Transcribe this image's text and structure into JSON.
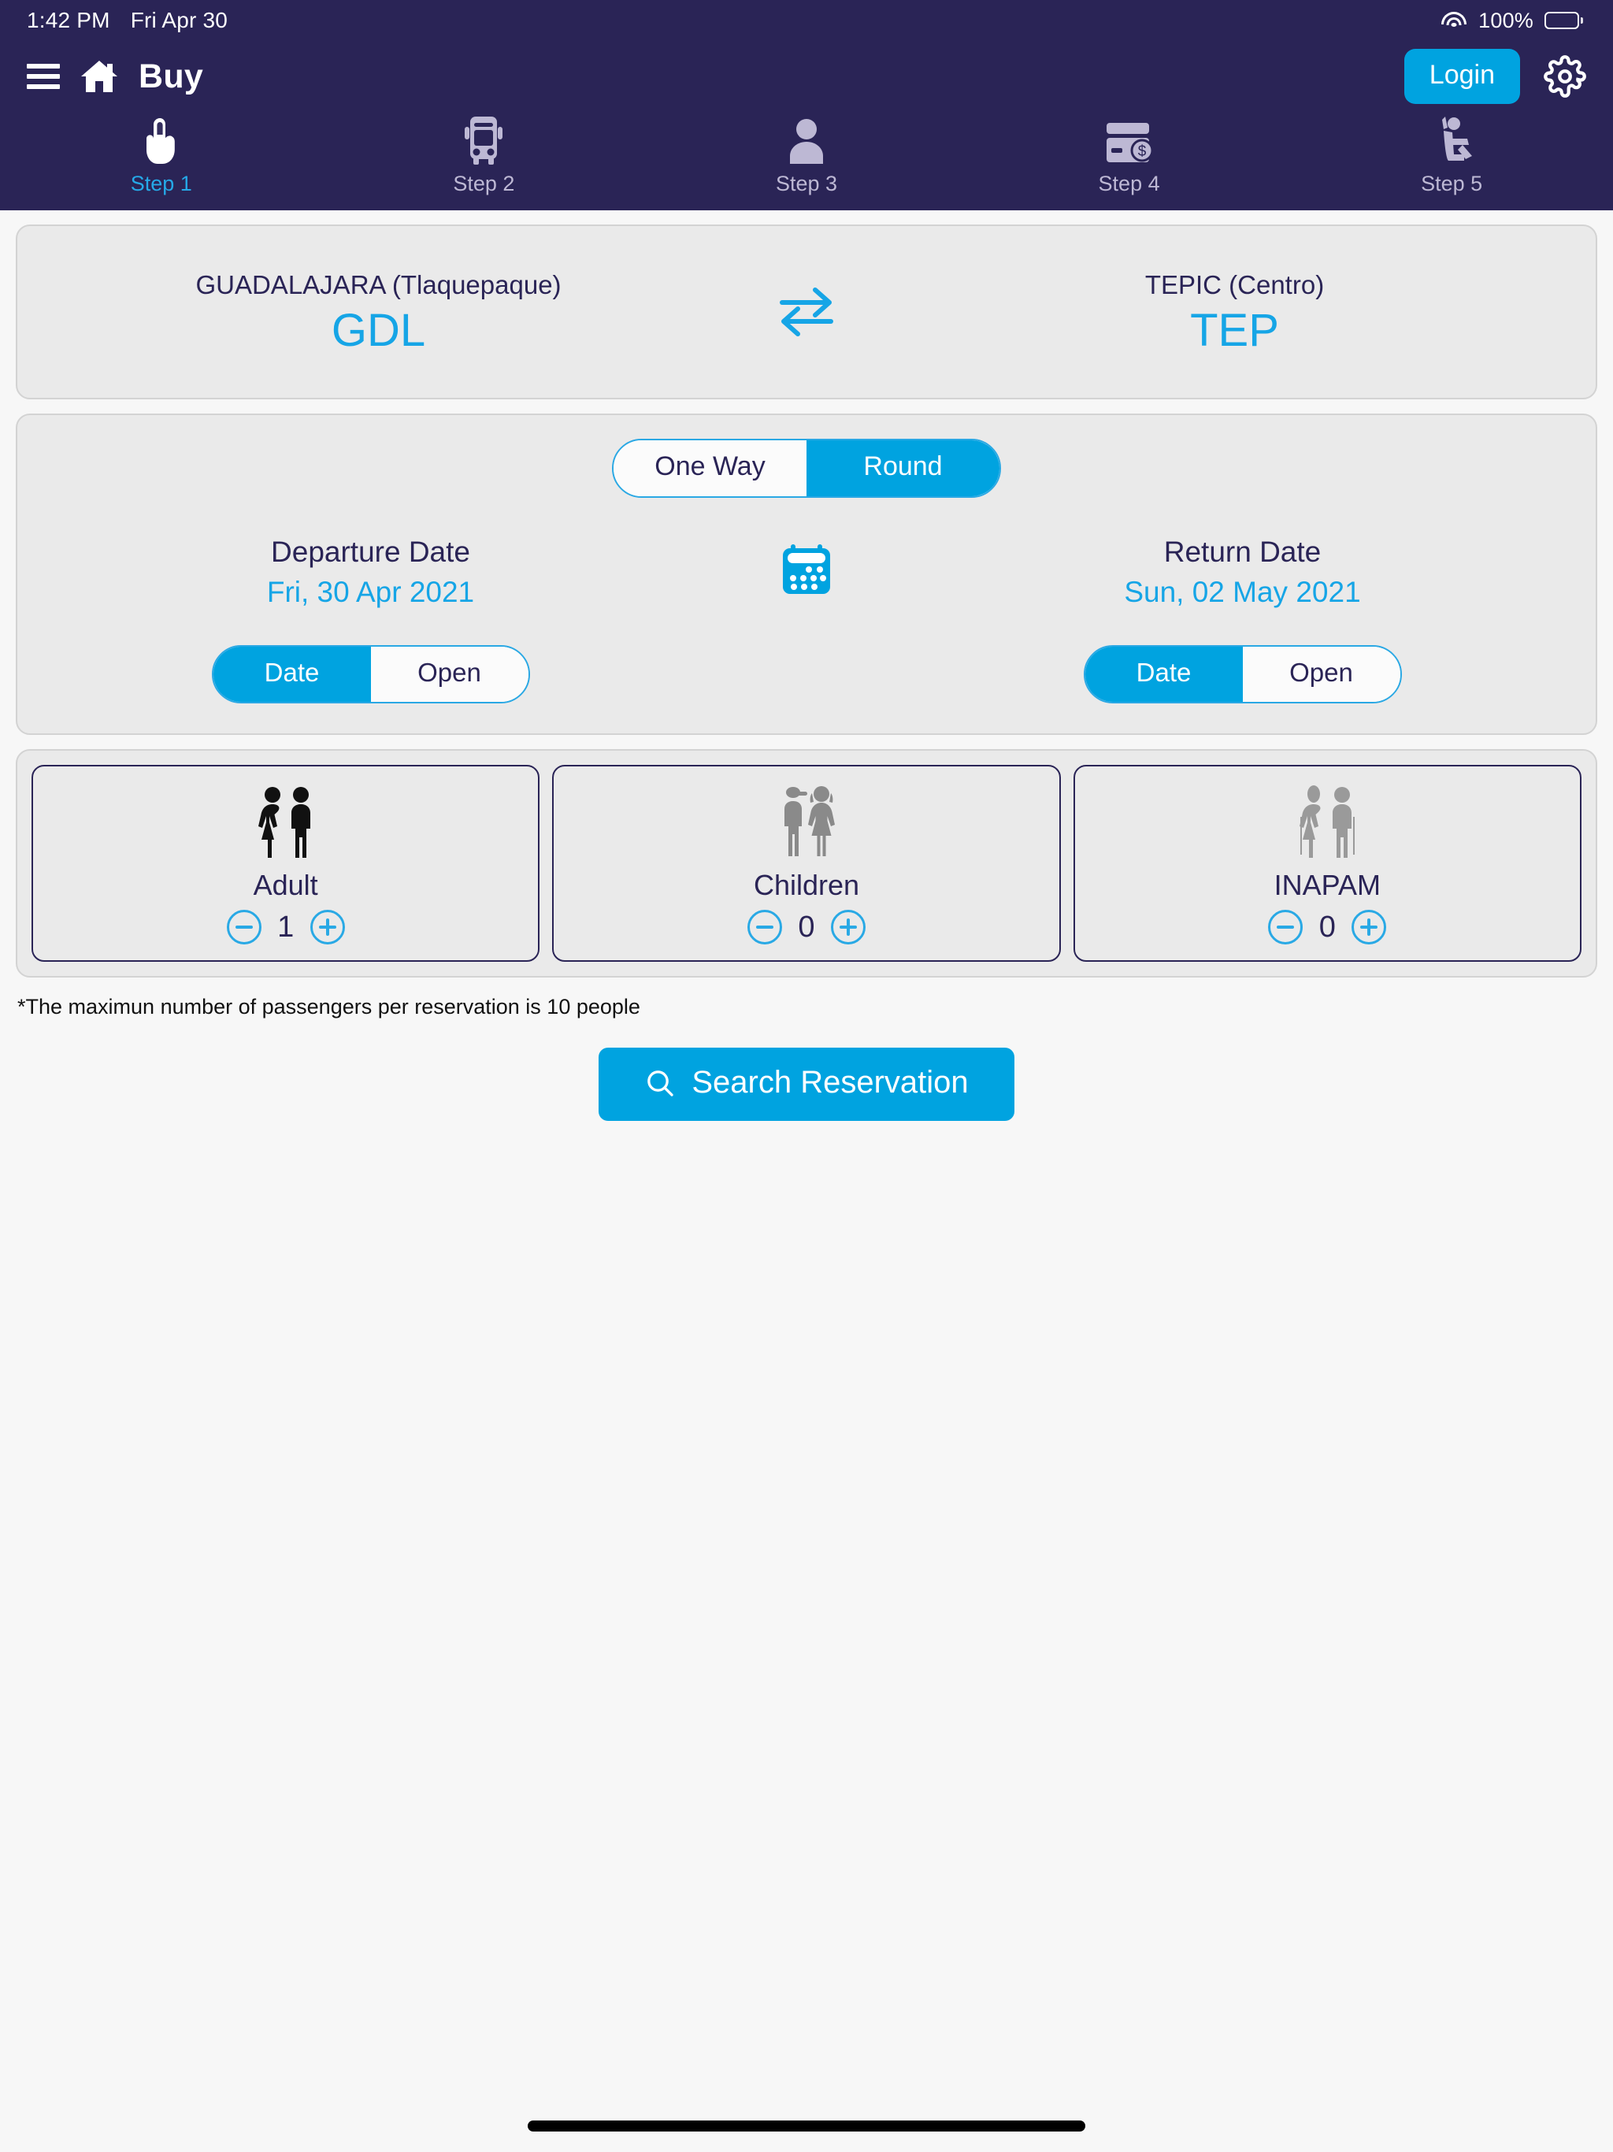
{
  "status_bar": {
    "time": "1:42 PM",
    "date": "Fri Apr 30",
    "battery_percent": "100%",
    "wifi_icon": "wifi-icon",
    "battery_icon": "battery-icon"
  },
  "header": {
    "menu_icon": "hamburger-menu-icon",
    "home_icon": "home-icon",
    "title": "Buy",
    "login_label": "Login",
    "settings_icon": "gear-icon"
  },
  "steps": [
    {
      "label": "Step 1",
      "icon": "tap-hand-icon",
      "active": true
    },
    {
      "label": "Step 2",
      "icon": "bus-icon",
      "active": false
    },
    {
      "label": "Step 3",
      "icon": "person-icon",
      "active": false
    },
    {
      "label": "Step 4",
      "icon": "payment-card-icon",
      "active": false
    },
    {
      "label": "Step 5",
      "icon": "seat-passenger-icon",
      "active": false
    }
  ],
  "route": {
    "origin_city": "GUADALAJARA (Tlaquepaque)",
    "origin_code": "GDL",
    "destination_city": "TEPIC (Centro)",
    "destination_code": "TEP",
    "swap_icon": "swap-arrows-icon"
  },
  "trip_type": {
    "options": [
      "One Way",
      "Round"
    ],
    "selected": "Round"
  },
  "departure": {
    "title": "Departure Date",
    "value": "Fri, 30 Apr 2021",
    "options": [
      "Date",
      "Open"
    ],
    "selected": "Date"
  },
  "return": {
    "title": "Return Date",
    "value": "Sun, 02 May 2021",
    "options": [
      "Date",
      "Open"
    ],
    "selected": "Date"
  },
  "calendar_icon": "calendar-icon",
  "passengers": [
    {
      "label": "Adult",
      "count": "1",
      "icon": "adult-couple-icon",
      "icon_color": "#111111"
    },
    {
      "label": "Children",
      "count": "0",
      "icon": "children-icon",
      "icon_color": "#8A8A8A"
    },
    {
      "label": "INAPAM",
      "count": "0",
      "icon": "senior-couple-icon",
      "icon_color": "#9A9A9A"
    }
  ],
  "note": "*The maximun number of passengers per reservation is 10 people",
  "search_button": {
    "label": "Search Reservation",
    "icon": "search-icon"
  },
  "colors": {
    "header_navy": "#2A2456",
    "accent_cyan": "#00A3E0",
    "link_cyan": "#16A5E6",
    "panel_bg": "#EAEAEA",
    "page_bg": "#F7F7F7"
  }
}
